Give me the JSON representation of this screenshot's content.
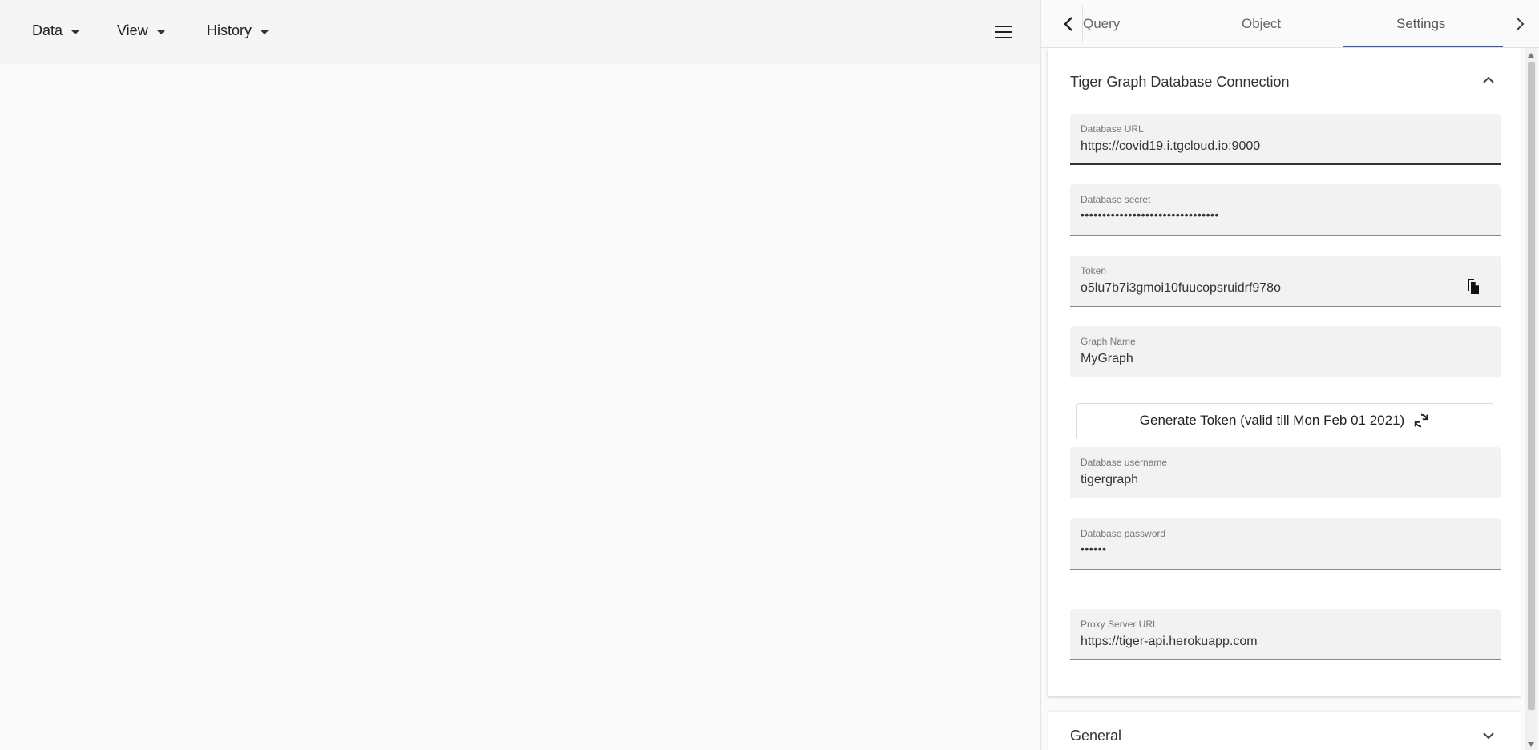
{
  "menubar": {
    "data_label": "Data",
    "view_label": "View",
    "history_label": "History"
  },
  "tabs": [
    {
      "label": "Query"
    },
    {
      "label": "Object"
    },
    {
      "label": "Settings"
    }
  ],
  "active_tab": "Settings",
  "connection": {
    "title": "Tiger Graph Database Connection",
    "db_url": {
      "label": "Database URL",
      "value": "https://covid19.i.tgcloud.io:9000"
    },
    "db_secret": {
      "label": "Database secret",
      "value": "••••••••••••••••••••••••••••••••"
    },
    "token": {
      "label": "Token",
      "value": "o5lu7b7i3gmoi10fuucopsruidrf978o"
    },
    "graph_name": {
      "label": "Graph Name",
      "value": "MyGraph"
    },
    "generate_button": "Generate Token (valid till Mon Feb 01 2021)",
    "db_username": {
      "label": "Database username",
      "value": "tigergraph"
    },
    "db_password": {
      "label": "Database password",
      "value": "••••••"
    },
    "proxy_url": {
      "label": "Proxy Server URL",
      "value": "https://tiger-api.herokuapp.com"
    }
  },
  "general": {
    "title": "General"
  },
  "colors": {
    "tab_indicator": "#3f51b5",
    "background": "#fafafa"
  }
}
